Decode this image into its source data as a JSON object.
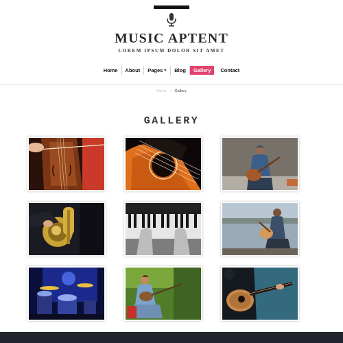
{
  "header": {
    "brand": "MUSIC APTENT",
    "tagline": "LOREM IPSUM DOLOR SIT AMET",
    "logo_icon": "microphone-icon"
  },
  "nav": {
    "items": [
      {
        "label": "Home"
      },
      {
        "label": "About"
      },
      {
        "label": "Pages"
      },
      {
        "label": "Blog"
      },
      {
        "label": "Gallery"
      },
      {
        "label": "Contact"
      }
    ],
    "active": "Gallery",
    "active_color": "#e0446e"
  },
  "breadcrumb": {
    "home": "Home",
    "separator": "/",
    "current": "Gallery"
  },
  "page": {
    "title": "GALLERY"
  },
  "gallery": {
    "images": [
      "cello-photo",
      "acoustic-guitar-closeup-photo",
      "guitarist-by-stone-wall-photo",
      "tuba-player-photo",
      "piano-keys-photo",
      "guitarist-by-lake-photo",
      "drummer-on-stage-photo",
      "woman-with-mandolin-photo",
      "guitarist-blue-background-photo"
    ]
  },
  "colors": {
    "accent": "#e0446e",
    "footer": "#24262f"
  }
}
